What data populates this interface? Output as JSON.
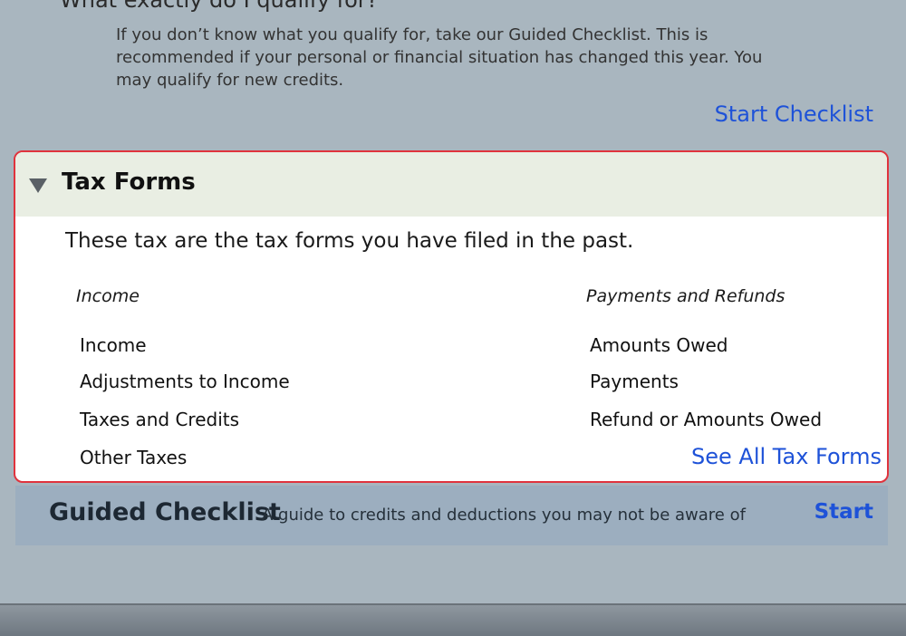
{
  "qualify_section": {
    "heading": "What exactly do I qualify for?",
    "description": "If you don’t know what you qualify for, take our Guided Checklist. This is recommended if your personal or financial situation has changed this year. You may qualify for new credits.",
    "start_link": "Start Checklist"
  },
  "tax_forms": {
    "title": "Tax Forms",
    "description": "These tax are the tax forms you have filed in the past.",
    "columns": [
      {
        "header": "Income",
        "items": [
          "Income",
          "Adjustments to Income",
          "Taxes and Credits",
          "Other Taxes"
        ]
      },
      {
        "header": "Payments and Refunds",
        "items": [
          "Amounts Owed",
          "Payments",
          "Refund or Amounts Owed"
        ]
      }
    ],
    "see_all_link": "See All Tax Forms",
    "border_color": "#e0333d",
    "header_bg": "#e9eee3"
  },
  "guided_checklist": {
    "title": "Guided Checklist",
    "subtitle": "A guide to credits and deductions you may not be aware of",
    "start_label": "Start"
  },
  "colors": {
    "background": "#a9b6bf",
    "link": "#1e52d8"
  }
}
